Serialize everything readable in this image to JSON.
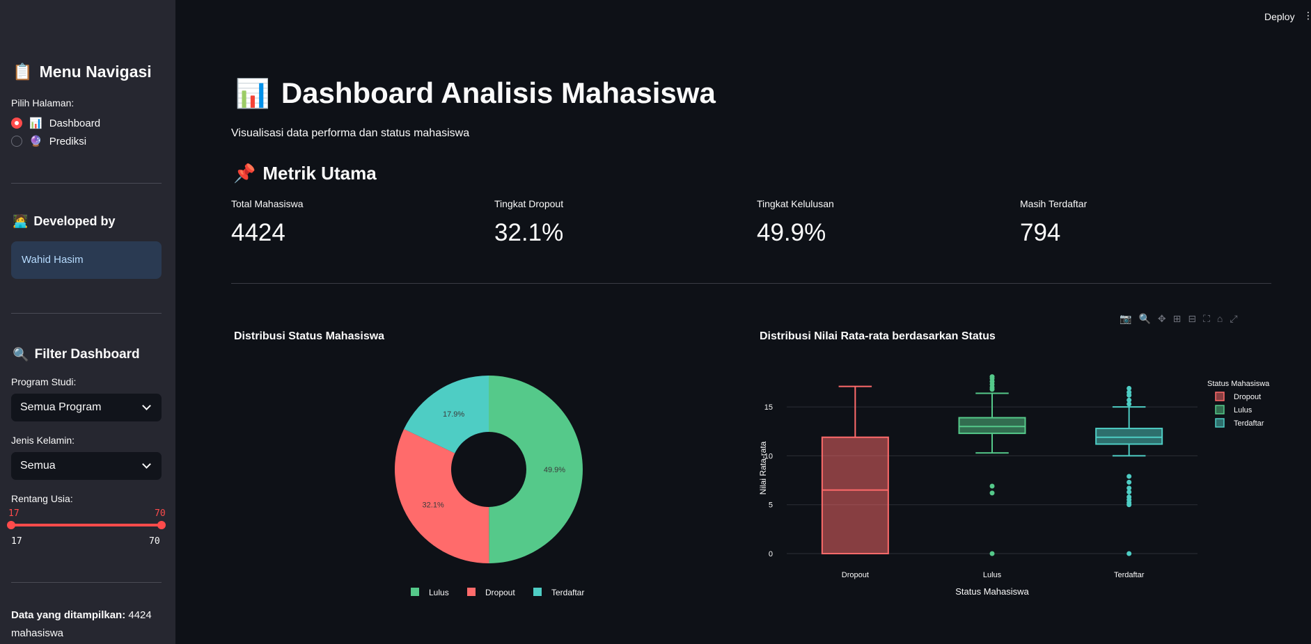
{
  "sidebar": {
    "menu_title": "Menu Navigasi",
    "page_label": "Pilih Halaman:",
    "pages": [
      {
        "label": "Dashboard",
        "selected": true
      },
      {
        "label": "Prediksi",
        "selected": false
      }
    ],
    "developed_by_title": "Developed by",
    "developer_name": "Wahid Hasim",
    "filter_title": "Filter Dashboard",
    "program_label": "Program Studi:",
    "program_value": "Semua Program",
    "gender_label": "Jenis Kelamin:",
    "gender_value": "Semua",
    "age_label": "Rentang Usia:",
    "age_min": "17",
    "age_max": "70",
    "age_range_min": "17",
    "age_range_max": "70",
    "footer_bold": "Data yang ditampilkan:",
    "footer_rest": "4424 mahasiswa"
  },
  "header": {
    "deploy_label": "Deploy",
    "menu_icon": "⋮"
  },
  "main": {
    "title": "Dashboard Analisis Mahasiswa",
    "subtitle": "Visualisasi data performa dan status mahasiswa",
    "metrics_title": "Metrik Utama",
    "metrics": [
      {
        "label": "Total Mahasiswa",
        "value": "4424"
      },
      {
        "label": "Tingkat Dropout",
        "value": "32.1%"
      },
      {
        "label": "Tingkat Kelulusan",
        "value": "49.9%"
      },
      {
        "label": "Masih Terdaftar",
        "value": "794"
      }
    ]
  },
  "colors": {
    "accent": "#ff4b4b",
    "lulus": "#55c98a",
    "dropout": "#ff6b6b",
    "terdaftar": "#4ecdc4"
  },
  "chart_data": [
    {
      "type": "pie",
      "title": "Distribusi Status Mahasiswa",
      "hole": true,
      "labels": [
        "Lulus",
        "Dropout",
        "Terdaftar"
      ],
      "values": [
        49.9,
        32.1,
        17.9
      ],
      "value_labels": [
        "49.9%",
        "32.1%",
        "17.9%"
      ],
      "colors": [
        "#55c98a",
        "#ff6b6b",
        "#4ecdc4"
      ],
      "legend": "bottom"
    },
    {
      "type": "box",
      "title": "Distribusi Nilai Rata-rata berdasarkan Status",
      "xlabel": "Status Mahasiswa",
      "ylabel": "Nilai Rata-rata",
      "ylim": [
        0,
        17.5
      ],
      "yticks": [
        0,
        5,
        10,
        15
      ],
      "legend_title": "Status Mahasiswa",
      "legend": "top-right",
      "categories": [
        "Dropout",
        "Lulus",
        "Terdaftar"
      ],
      "colors": [
        "#ff6b6b",
        "#55c98a",
        "#4ecdc4"
      ],
      "boxes": [
        {
          "name": "Dropout",
          "min": 0,
          "q1": 0,
          "median": 6.5,
          "q3": 11.9,
          "max": 17.1,
          "outliers": []
        },
        {
          "name": "Lulus",
          "min": 10.3,
          "q1": 12.3,
          "median": 13.0,
          "q3": 13.9,
          "max": 16.4,
          "outliers": [
            0,
            6.2,
            6.9,
            16.8,
            17.0,
            17.3,
            17.6,
            17.9,
            18.1
          ]
        },
        {
          "name": "Terdaftar",
          "min": 10.0,
          "q1": 11.2,
          "median": 11.9,
          "q3": 12.8,
          "max": 15.0,
          "outliers": [
            0,
            5.0,
            5.2,
            5.5,
            5.8,
            6.3,
            6.7,
            7.3,
            7.9,
            15.3,
            15.7,
            16.2,
            16.5,
            16.9
          ]
        }
      ]
    }
  ]
}
